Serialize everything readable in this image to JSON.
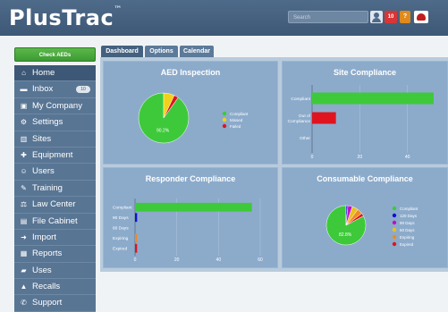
{
  "header": {
    "logo": "PlusTrac",
    "trademark": "™",
    "search_placeholder": "Search",
    "notification_count": "10",
    "help_label": "?"
  },
  "sidebar": {
    "check_button": "Check AEDs",
    "items": [
      {
        "label": "Home",
        "icon": "home-icon"
      },
      {
        "label": "Inbox",
        "icon": "inbox-icon",
        "badge": "10"
      },
      {
        "label": "My Company",
        "icon": "company-icon"
      },
      {
        "label": "Settings",
        "icon": "gear-icon"
      },
      {
        "label": "Sites",
        "icon": "building-icon"
      },
      {
        "label": "Equipment",
        "icon": "plus-icon"
      },
      {
        "label": "Users",
        "icon": "users-icon"
      },
      {
        "label": "Training",
        "icon": "training-icon"
      },
      {
        "label": "Law Center",
        "icon": "scales-icon"
      },
      {
        "label": "File Cabinet",
        "icon": "file-icon"
      },
      {
        "label": "Import",
        "icon": "import-icon"
      },
      {
        "label": "Reports",
        "icon": "report-icon"
      },
      {
        "label": "Uses",
        "icon": "briefcase-icon"
      },
      {
        "label": "Recalls",
        "icon": "warning-icon"
      },
      {
        "label": "Support",
        "icon": "support-icon"
      }
    ]
  },
  "tabs": [
    "Dashboard",
    "Options",
    "Calendar"
  ],
  "panels": {
    "aed": "AED Inspection",
    "site": "Site Compliance",
    "responder": "Responder Compliance",
    "consumable": "Consumable Compliance"
  },
  "colors": {
    "green": "#3ec93a",
    "yellow": "#f0d21a",
    "red": "#e0141e",
    "blue": "#1010d0",
    "magenta": "#c010c8",
    "gold": "#e8c020",
    "orange": "#f08a20"
  },
  "chart_data": [
    {
      "type": "pie",
      "title": "AED Inspection",
      "labels": [
        "Compliant",
        "Missed",
        "Failed"
      ],
      "values": [
        90.2,
        7.0,
        2.8
      ],
      "slice_label": "90.2%"
    },
    {
      "type": "bar",
      "orientation": "horizontal",
      "title": "Site Compliance",
      "categories": [
        "Compliant",
        "Out of Compliance",
        "Other"
      ],
      "values": [
        51,
        10,
        0
      ],
      "xlim": [
        0,
        60
      ],
      "ticks": [
        0,
        20,
        40,
        60
      ]
    },
    {
      "type": "bar",
      "orientation": "horizontal",
      "title": "Responder Compliance",
      "categories": [
        "Compliant",
        "90 Days",
        "60 Days",
        "Expiring",
        "Expired"
      ],
      "values": [
        56,
        1,
        0,
        1,
        1
      ],
      "xlim": [
        0,
        60
      ],
      "ticks": [
        0,
        20,
        40,
        60
      ]
    },
    {
      "type": "pie",
      "title": "Consumable Compliance",
      "labels": [
        "Compliant",
        "120 Days",
        "90 Days",
        "60 Days",
        "Expiring",
        "Expired"
      ],
      "values": [
        82.8,
        1.5,
        3.7,
        5.0,
        4.5,
        2.5
      ],
      "slice_label": "82.8%"
    }
  ]
}
